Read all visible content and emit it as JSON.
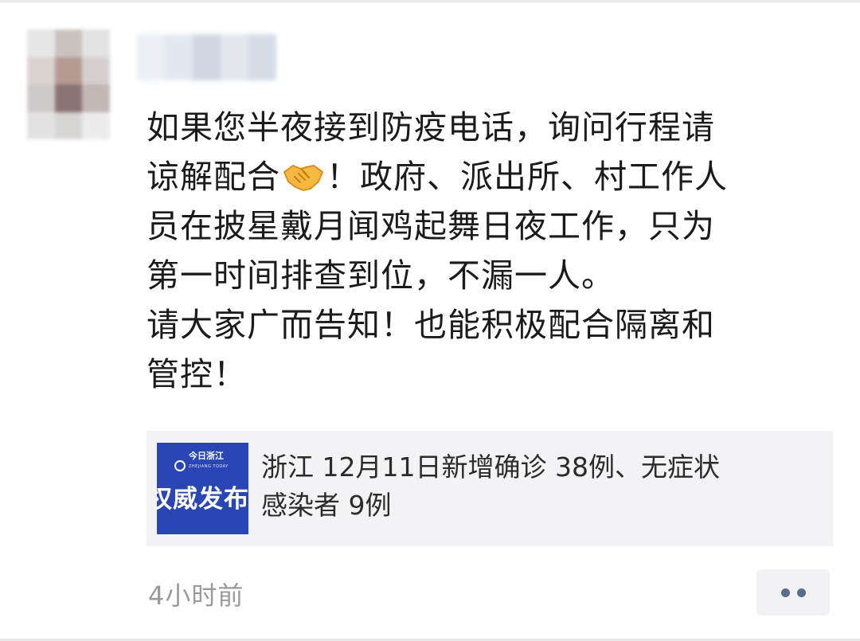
{
  "post": {
    "lines": [
      "如果您半夜接到防疫电话，询问行程请",
      "谅解配合",
      "！政府、派出所、村工作人",
      "员在披星戴月闻鸡起舞日夜工作，只为",
      "第一时间排查到位，不漏一人。",
      "请大家广而告知！也能积极配合隔离和",
      "管控！"
    ],
    "emoji": "handshake-icon"
  },
  "link_card": {
    "thumbnail": {
      "logo_text": "今日浙江",
      "logo_subtext": "ZHEJIANG TODAY",
      "title": "权威发布"
    },
    "title_lines": [
      "浙江 12月11日新增确诊 38例、无症状",
      "感染者 9例"
    ]
  },
  "meta": {
    "timestamp": "4小时前",
    "more_icon": "more-dots-icon"
  },
  "colors": {
    "text": "#1b1b1b",
    "timestamp": "#9a9a9a",
    "card_bg": "#f3f3f5",
    "thumb_bg": "#2a46b5",
    "dots": "#5a6b8c"
  }
}
